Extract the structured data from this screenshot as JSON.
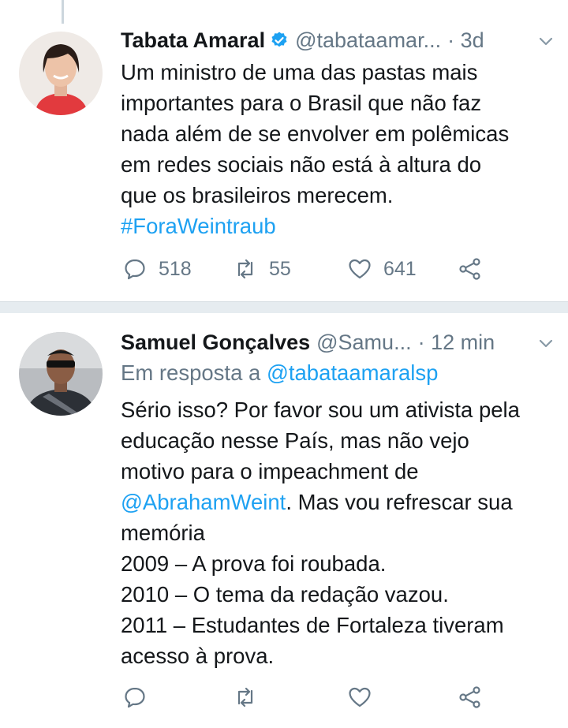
{
  "tweets": [
    {
      "author_name": "Tabata Amaral",
      "verified": true,
      "handle": "@tabataamar...",
      "time": "· 3d",
      "lines": [
        "Um ministro de uma das pastas mais",
        "importantes para o Brasil que não faz",
        "nada além de se envolver em polêmicas",
        "em redes sociais não está à altura do",
        "que os brasileiros merecem."
      ],
      "hashtag": "#ForaWeintraub",
      "reply_count": "518",
      "retweet_count": "55",
      "like_count": "641"
    },
    {
      "author_name": "Samuel Gonçalves",
      "handle": "@Samu...",
      "time": "· 12 min",
      "reply_prefix": "Em resposta a ",
      "reply_mention": "@tabataamaralsp",
      "lines": [
        "Sério isso? Por favor sou um ativista pela",
        "educação nesse País, mas não vejo",
        "motivo para o impeachment de"
      ],
      "mention": "@AbrahamWeint",
      "mention_tail": ". Mas vou refrescar sua",
      "lines_after": [
        "memória",
        "2009 –  A prova foi roubada.",
        "2010 – O tema da redação vazou.",
        "2011 – Estudantes de Fortaleza tiveram",
        "acesso à prova."
      ]
    }
  ],
  "icons": {
    "reply": "reply-icon",
    "retweet": "retweet-icon",
    "like": "heart-icon",
    "share": "share-icon",
    "verified": "verified-badge-icon",
    "chevron": "chevron-down-icon"
  },
  "colors": {
    "link": "#1da1f2",
    "muted": "#657786",
    "text": "#14171a",
    "separator": "#e6ecf0"
  }
}
